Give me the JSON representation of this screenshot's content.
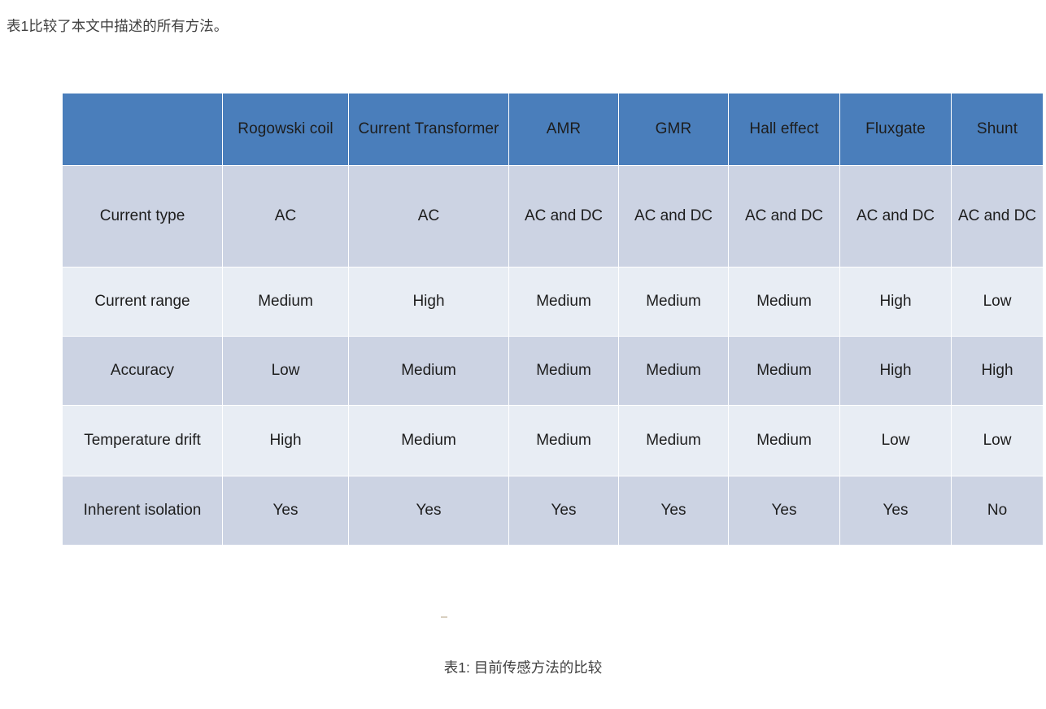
{
  "document": {
    "intro_text": "表1比较了本文中描述的所有方法。",
    "caption": "表1: 目前传感方法的比较"
  },
  "colors": {
    "header_blue": "#4a7ebb",
    "band_dark": "#ccd3e3",
    "band_light": "#e8edf4",
    "header_text": "#ffffff",
    "body_text": "#1d1d1d",
    "page_background": "#ffffff"
  },
  "table": {
    "headers": [
      "",
      "Rogowski coil",
      "Current Transformer",
      "AMR",
      "GMR",
      "Hall effect",
      "Fluxgate",
      "Shunt"
    ],
    "rows": [
      {
        "label": "Current type",
        "cells": [
          "AC",
          "AC",
          "AC and DC",
          "AC and DC",
          "AC and DC",
          "AC and DC",
          "AC and DC"
        ]
      },
      {
        "label": "Current range",
        "cells": [
          "Medium",
          "High",
          "Medium",
          "Medium",
          "Medium",
          "High",
          "Low"
        ]
      },
      {
        "label": "Accuracy",
        "cells": [
          "Low",
          "Medium",
          "Medium",
          "Medium",
          "Medium",
          "High",
          "High"
        ]
      },
      {
        "label": "Temperature drift",
        "cells": [
          "High",
          "Medium",
          "Medium",
          "Medium",
          "Medium",
          "Low",
          "Low"
        ]
      },
      {
        "label": "Inherent isolation",
        "cells": [
          "Yes",
          "Yes",
          "Yes",
          "Yes",
          "Yes",
          "Yes",
          "No"
        ]
      }
    ]
  }
}
